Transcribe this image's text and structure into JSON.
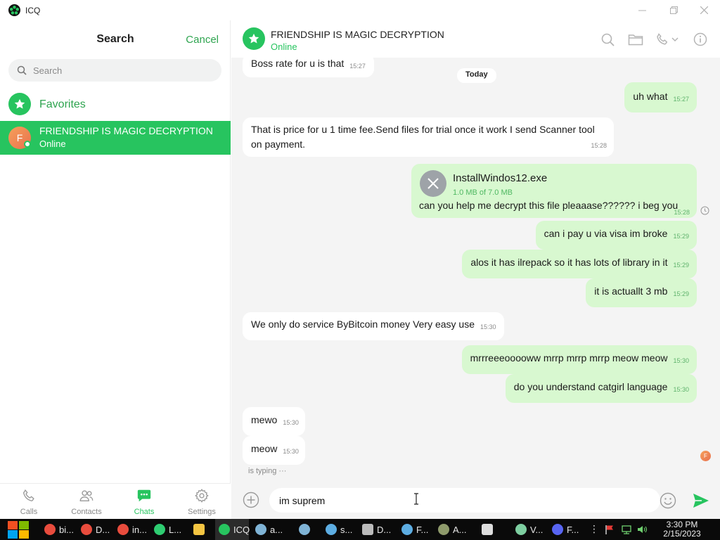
{
  "app": {
    "title": "ICQ"
  },
  "sidebar": {
    "search_title": "Search",
    "cancel_label": "Cancel",
    "search_placeholder": "Search",
    "favorites_label": "Favorites",
    "chats": [
      {
        "name": "FRIENDSHIP IS MAGIC DECRYPTION",
        "status": "Online",
        "avatar_letter": "F"
      }
    ]
  },
  "nav": {
    "calls": "Calls",
    "contacts": "Contacts",
    "chats": "Chats",
    "settings": "Settings"
  },
  "chat": {
    "name": "FRIENDSHIP IS MAGIC DECRYPTION",
    "status": "Online",
    "date_separator": "Today",
    "typing": "is typing ···",
    "mini_avatar_letter": "F",
    "messages": [
      {
        "dir": "in",
        "text": "Boss rate for u is that",
        "time": "15:27"
      },
      {
        "dir": "out",
        "text": "uh what",
        "time": "15:27"
      },
      {
        "dir": "in",
        "text": "That is price for u 1 time fee.Send files for trial once it work I send Scanner tool on payment.",
        "time": "15:28"
      },
      {
        "dir": "out",
        "file_name": "InstallWindos12.exe",
        "file_size": "1.0 MB of 7.0 MB",
        "text": "can you help me decrypt this file pleaaase?????? i beg you",
        "time": "15:28"
      },
      {
        "dir": "out",
        "text": "can i pay u via visa im broke",
        "time": "15:29"
      },
      {
        "dir": "out",
        "text": "alos it has ilrepack so it has lots of library in it",
        "time": "15:29"
      },
      {
        "dir": "out",
        "text": "it is actuallt 3 mb",
        "time": "15:29"
      },
      {
        "dir": "in",
        "text": "We only do service ByBitcoin money Very easy use",
        "time": "15:30"
      },
      {
        "dir": "out",
        "text": "mrrreeeooooww mrrp mrrp mrrp meow meow",
        "time": "15:30"
      },
      {
        "dir": "out",
        "text": "do you understand catgirl language",
        "time": "15:30"
      },
      {
        "dir": "in",
        "text": "mewo",
        "time": "15:30"
      },
      {
        "dir": "in",
        "text": "meow",
        "time": "15:30"
      }
    ]
  },
  "composer": {
    "value": "im suprem"
  },
  "taskbar": {
    "items": [
      {
        "label": "bi...",
        "icon_color": "#e84c3d"
      },
      {
        "label": "D...",
        "icon_color": "#e84c3d"
      },
      {
        "label": "in...",
        "icon_color": "#e84c3d"
      },
      {
        "label": "L...",
        "icon_color": "#2ecc71"
      },
      {
        "label": "",
        "icon_color": "#f4c542"
      },
      {
        "label": "ICQ",
        "icon_color": "#27c45f"
      },
      {
        "label": "a...",
        "icon_color": "#7fb3d5"
      },
      {
        "label": "",
        "icon_color": "#7fb3d5"
      },
      {
        "label": "s...",
        "icon_color": "#5dade2"
      },
      {
        "label": "D...",
        "icon_color": "#bbbbbb"
      },
      {
        "label": "F...",
        "icon_color": "#5dade2"
      },
      {
        "label": "A...",
        "icon_color": "#8e9a6b"
      },
      {
        "label": "",
        "icon_color": "#dddddd"
      },
      {
        "label": "V...",
        "icon_color": "#7dcea0"
      },
      {
        "label": "F...",
        "icon_color": "#5865f2"
      }
    ],
    "time": "3:30 PM",
    "date": "2/15/2023"
  }
}
